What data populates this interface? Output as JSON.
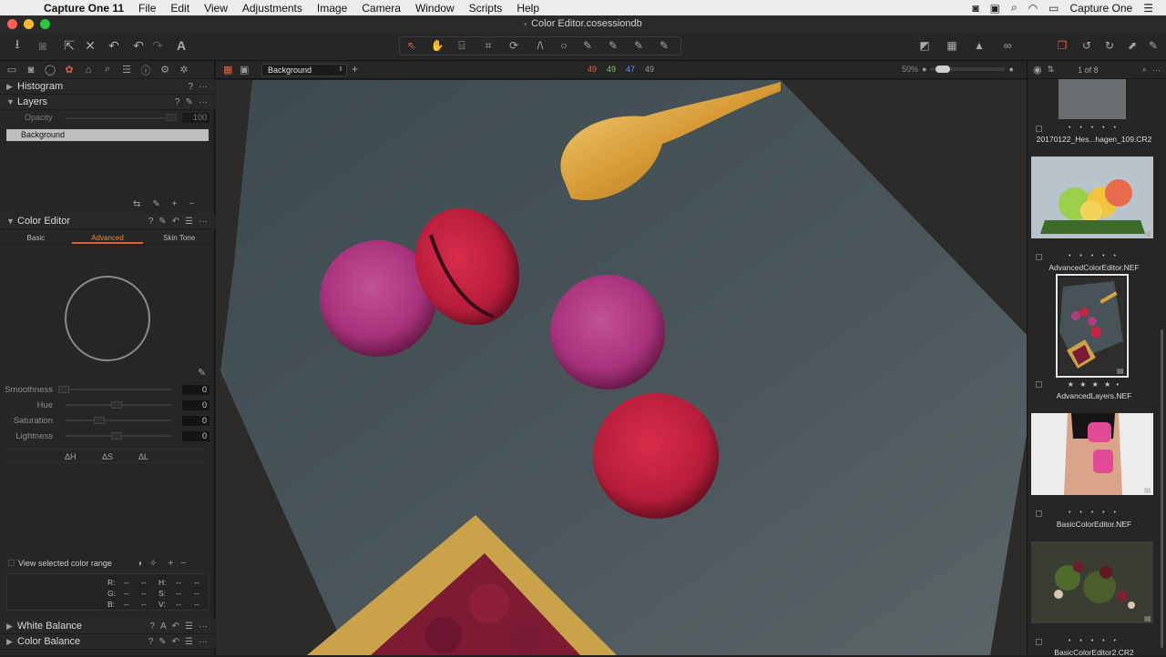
{
  "menubar": {
    "app_name": "Capture One 11",
    "items": [
      "File",
      "Edit",
      "View",
      "Adjustments",
      "Image",
      "Camera",
      "Window",
      "Scripts",
      "Help"
    ],
    "right_app": "Capture One"
  },
  "window": {
    "title": "Color Editor.cosessiondb"
  },
  "viewer_header": {
    "layer_name": "Background",
    "counters": [
      {
        "value": "49",
        "color": "#e2613a"
      },
      {
        "value": "49",
        "color": "#7ec850"
      },
      {
        "value": "47",
        "color": "#6f8cff"
      },
      {
        "value": "49",
        "color": "#9a9a9a"
      }
    ],
    "zoom": "50%"
  },
  "left": {
    "histogram_title": "Histogram",
    "layers_title": "Layers",
    "opacity_label": "Opacity",
    "opacity_value": "100",
    "layer_item": "Background",
    "color_editor_title": "Color Editor",
    "tabs": [
      "Basic",
      "Advanced",
      "Skin Tone"
    ],
    "sliders": [
      {
        "label": "Smoothness",
        "value": "0"
      },
      {
        "label": "Hue",
        "value": "0"
      },
      {
        "label": "Saturation",
        "value": "0"
      },
      {
        "label": "Lightness",
        "value": "0"
      }
    ],
    "deltas": [
      "ΔH",
      "ΔS",
      "ΔL"
    ],
    "view_range_label": "View selected color range",
    "readout": {
      "r_label": "R:",
      "r1": "--",
      "r2": "--",
      "g_label": "G:",
      "g1": "--",
      "g2": "--",
      "b_label": "B:",
      "b1": "--",
      "b2": "--",
      "h_label": "H:",
      "h1": "--",
      "h2": "--",
      "s_label": "S:",
      "s1": "--",
      "s2": "--",
      "v_label": "V:",
      "v1": "--",
      "v2": "--"
    },
    "white_balance_title": "White Balance",
    "color_balance_title": "Color Balance"
  },
  "browser": {
    "count": "1 of 8",
    "items": [
      {
        "name": "20170122_Hes...hagen_109.CR2",
        "stars": "• • • • •"
      },
      {
        "name": "AdvancedColorEditor.NEF",
        "stars": "• • • • •"
      },
      {
        "name": "AdvancedLayers.NEF",
        "stars": "★ ★ ★ ★ •"
      },
      {
        "name": "BasicColorEditor.NEF",
        "stars": "• • • • •"
      },
      {
        "name": "BasicColorEditor2.CR2",
        "stars": "• • • • •"
      }
    ]
  }
}
